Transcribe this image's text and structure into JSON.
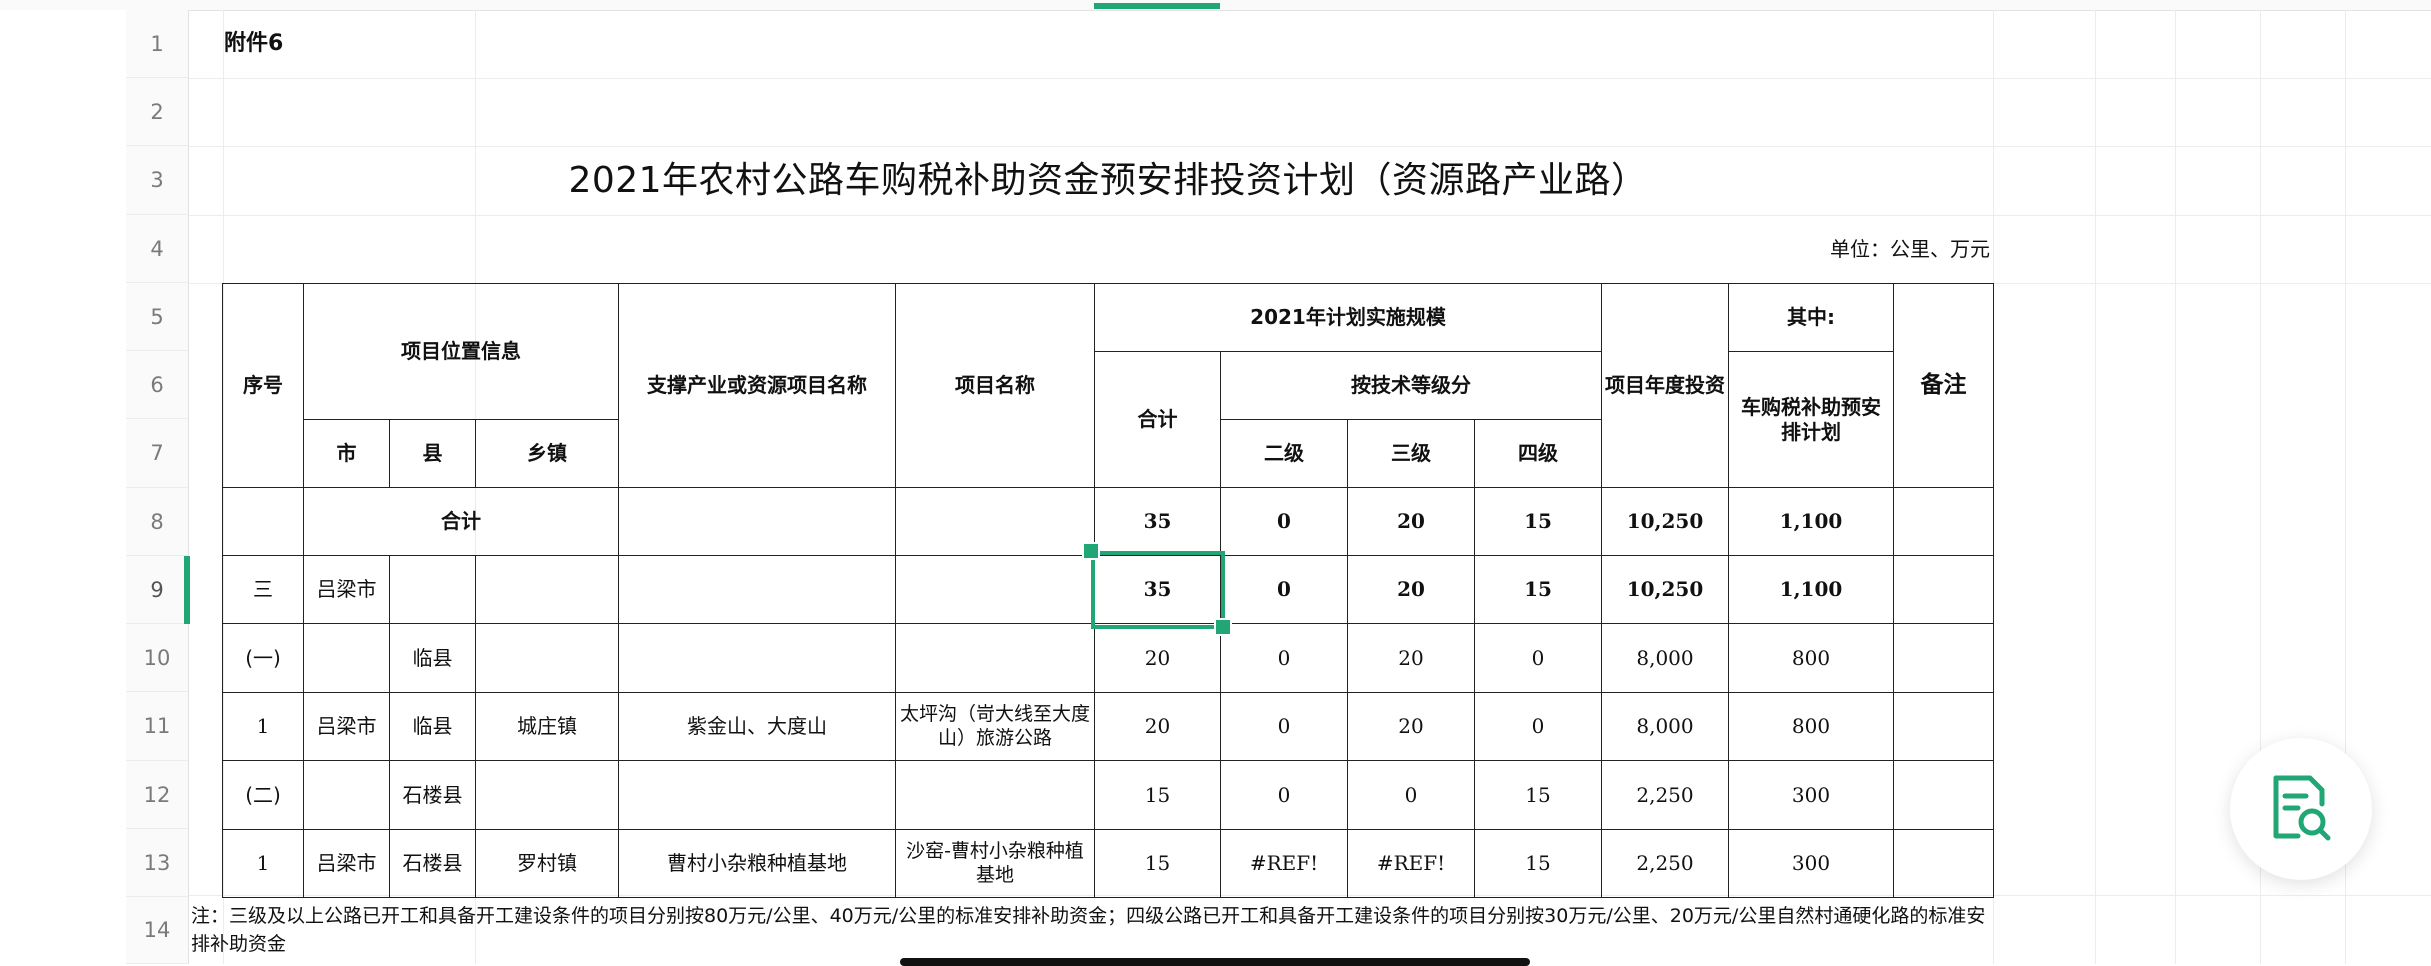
{
  "row_numbers": [
    "1",
    "2",
    "3",
    "4",
    "5",
    "6",
    "7",
    "8",
    "9",
    "10",
    "11",
    "12",
    "13",
    "14"
  ],
  "sheet": {
    "attachment_label": "附件6",
    "title": "2021年农村公路车购税补助资金预安排投资计划（资源路产业路）",
    "unit": "单位：公里、万元",
    "headers": {
      "seq": "序号",
      "location": "项目位置信息",
      "city": "市",
      "county": "县",
      "town": "乡镇",
      "industry": "支撑产业或资源项目名称",
      "project": "项目名称",
      "scale_2021": "2021年计划实施规模",
      "total": "合计",
      "by_grade": "按技术等级分",
      "grade2": "二级",
      "grade3": "三级",
      "grade4": "四级",
      "annual_invest": "项目年度投资",
      "of_which": "其中:",
      "tax_subsidy": "车购税补助预安排计划",
      "remarks": "备注"
    },
    "total_row": {
      "label": "合计",
      "total": "35",
      "g2": "0",
      "g3": "20",
      "g4": "15",
      "invest": "10,250",
      "subsidy": "1,100"
    },
    "rows": [
      {
        "seq": "三",
        "city": "吕梁市",
        "county": "",
        "town": "",
        "industry": "",
        "project": "",
        "total": "35",
        "g2": "0",
        "g3": "20",
        "g4": "15",
        "invest": "10,250",
        "subsidy": "1,100",
        "remarks": ""
      },
      {
        "seq": "(一)",
        "city": "",
        "county": "临县",
        "town": "",
        "industry": "",
        "project": "",
        "total": "20",
        "g2": "0",
        "g3": "20",
        "g4": "0",
        "invest": "8,000",
        "subsidy": "800",
        "remarks": ""
      },
      {
        "seq": "1",
        "city": "吕梁市",
        "county": "临县",
        "town": "城庄镇",
        "industry": "紫金山、大度山",
        "project": "太坪沟（岢大线至大度山）旅游公路",
        "total": "20",
        "g2": "0",
        "g3": "20",
        "g4": "0",
        "invest": "8,000",
        "subsidy": "800",
        "remarks": ""
      },
      {
        "seq": "(二)",
        "city": "",
        "county": "石楼县",
        "town": "",
        "industry": "",
        "project": "",
        "total": "15",
        "g2": "0",
        "g3": "0",
        "g4": "15",
        "invest": "2,250",
        "subsidy": "300",
        "remarks": ""
      },
      {
        "seq": "1",
        "city": "吕梁市",
        "county": "石楼县",
        "town": "罗村镇",
        "industry": "曹村小杂粮种植基地",
        "project": "沙窑-曹村小杂粮种植基地",
        "total": "15",
        "g2": "#REF!",
        "g3": "#REF!",
        "g4": "15",
        "invest": "2,250",
        "subsidy": "300",
        "remarks": ""
      }
    ],
    "note": "注：三级及以上公路已开工和具备开工建设条件的项目分别按80万元/公里、40万元/公里的标准安排补助资金；四级公路已开工和具备开工建设条件的项目分别按30万元/公里、20万元/公里自然村通硬化路的标准安排补助资金"
  },
  "fab": {
    "icon": "document-search-icon"
  },
  "colors": {
    "accent": "#21a675",
    "border": "#222222",
    "grid": "#ececec"
  }
}
